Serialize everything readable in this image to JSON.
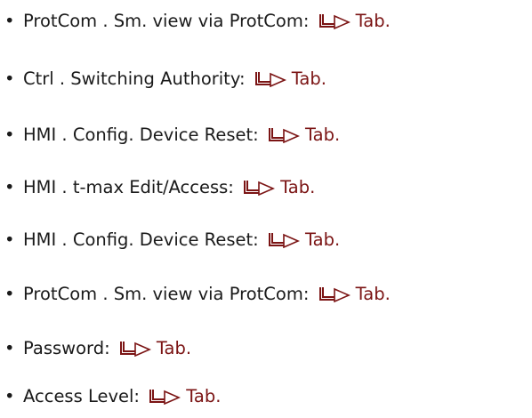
{
  "bullet_char": "•",
  "link_color": "#7b1414",
  "arrow_icon": "link-arrow-icon",
  "items": [
    {
      "label": "ProtCom . Sm. view via ProtCom:",
      "link": "Tab."
    },
    {
      "label": "Ctrl . Switching Authority:",
      "link": "Tab."
    },
    {
      "label": "HMI . Config. Device Reset:",
      "link": "Tab."
    },
    {
      "label": "HMI . t-max Edit/Access:",
      "link": "Tab."
    },
    {
      "label": "HMI . Config. Device Reset:",
      "link": "Tab."
    },
    {
      "label": "ProtCom . Sm. view via ProtCom:",
      "link": "Tab."
    },
    {
      "label": "Password:",
      "link": "Tab."
    },
    {
      "label": "Access Level:",
      "link": "Tab."
    }
  ]
}
